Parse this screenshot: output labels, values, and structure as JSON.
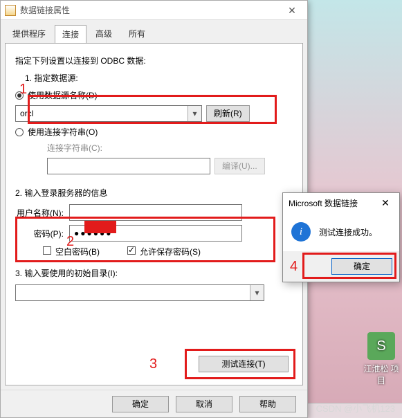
{
  "dialog": {
    "title": "数据链接属性",
    "tabs": [
      "提供程序",
      "连接",
      "高级",
      "所有"
    ],
    "active_tab": 1,
    "intro": "指定下列设置以连接到 ODBC 数据:",
    "sec1": "1. 指定数据源:",
    "opt_dsn": "使用数据源名称(D)",
    "dsn_value": "orcl",
    "refresh": "刷新(R)",
    "opt_connstr": "使用连接字符串(O)",
    "connstr_label": "连接字符串(C):",
    "compile": "编译(U)...",
    "sec2": "2. 输入登录服务器的信息",
    "user_label": "用户名称(N):",
    "pwd_label": "密码(P):",
    "pwd_mask": "●●●●●●",
    "chk_blank": "空白密码(B)",
    "chk_save": "允许保存密码(S)",
    "sec3": "3. 输入要使用的初始目录(I):",
    "test_btn": "测试连接(T)",
    "ok": "确定",
    "cancel": "取消",
    "help": "帮助"
  },
  "msg": {
    "title": "Microsoft 数据链接",
    "text": "测试连接成功。",
    "ok": "确定"
  },
  "markers": {
    "n1": "1",
    "n2": "2",
    "n3": "3",
    "n4": "4"
  },
  "desktop": {
    "label": "江淮松\n项目"
  },
  "watermark": "CSDN @小飞机123"
}
